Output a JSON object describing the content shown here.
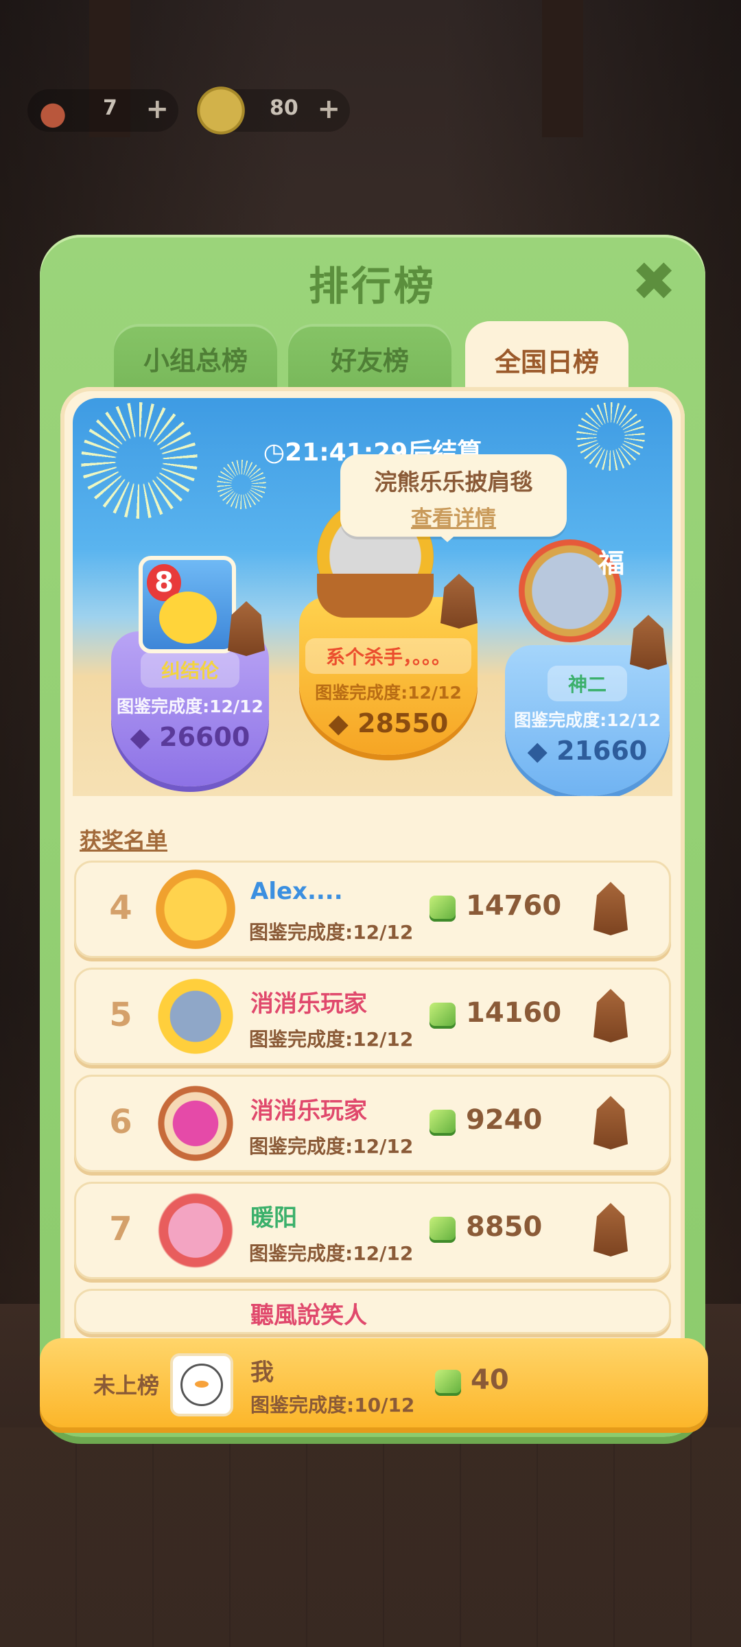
{
  "hud": {
    "left_count": "7",
    "right_count": "80",
    "plus": "+"
  },
  "panel": {
    "title": "排行榜",
    "close": "✖",
    "tabs": [
      {
        "label": "小组总榜",
        "active": false
      },
      {
        "label": "好友榜",
        "active": false
      },
      {
        "label": "全国日榜",
        "active": true
      }
    ]
  },
  "podium": {
    "timer": "21:41:29后结算",
    "tooltip": {
      "title": "浣熊乐乐披肩毯",
      "link": "查看详情"
    },
    "first": {
      "name": "系个杀手，。。。",
      "progress": "图鉴完成度:12/12",
      "score": "28550"
    },
    "second": {
      "name": "纠结伦",
      "progress": "图鉴完成度:12/12",
      "score": "26600",
      "badge": "8"
    },
    "third": {
      "name": "神二",
      "progress": "图鉴完成度:12/12",
      "score": "21660",
      "badge": "福"
    }
  },
  "award_title": "获奖名单",
  "rows": [
    {
      "rank": "4",
      "name": "Alex....",
      "progress": "图鉴完成度:12/12",
      "score": "14760"
    },
    {
      "rank": "5",
      "name": "消消乐玩家",
      "progress": "图鉴完成度:12/12",
      "score": "14160"
    },
    {
      "rank": "6",
      "name": "消消乐玩家",
      "progress": "图鉴完成度:12/12",
      "score": "9240"
    },
    {
      "rank": "7",
      "name": "暖阳",
      "progress": "图鉴完成度:12/12",
      "score": "8850"
    },
    {
      "rank": "",
      "name": "聽風說笑人"
    }
  ],
  "me": {
    "rank": "未上榜",
    "name": "我",
    "progress": "图鉴完成度:10/12",
    "score": "40"
  },
  "colors": {
    "panel_green": "#8ccb6d",
    "card_cream": "#fdf2d9",
    "gold": "#fcb62a",
    "text_brown": "#8a5a37"
  }
}
